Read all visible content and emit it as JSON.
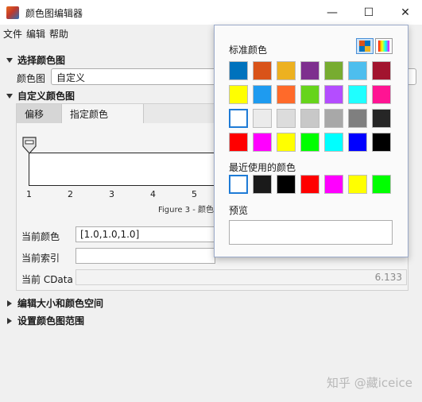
{
  "window": {
    "title": "颜色图编辑器",
    "min_symbol": "—",
    "max_symbol": "☐",
    "close_symbol": "✕"
  },
  "menu": [
    "文件",
    "编辑",
    "帮助"
  ],
  "sections": {
    "select_colormap": {
      "header": "选择颜色图",
      "colormap_label": "颜色图",
      "colormap_value": "自定义"
    },
    "custom_colormap": {
      "header": "自定义颜色图",
      "tabs": [
        "偏移",
        "指定颜色"
      ],
      "axis_ticks": [
        "1",
        "2",
        "3",
        "4",
        "5"
      ],
      "figure_label": "Figure 3 - 颜色",
      "current_color_label": "当前颜色",
      "current_color_value": "[1.0,1.0,1.0]",
      "current_index_label": "当前索引",
      "current_index_value": "",
      "current_cdata_label": "当前 CData",
      "current_cdata_value": "6.133"
    },
    "edit_size": {
      "header": "编辑大小和颜色空间"
    },
    "set_range": {
      "header": "设置颜色图范围"
    }
  },
  "popup": {
    "standard_colors_label": "标准颜色",
    "standard_colors": [
      [
        "#0072bd",
        "#d95319",
        "#edb120",
        "#7e2f8e",
        "#77ac30",
        "#4dbeee",
        "#a2142f"
      ],
      [
        "#ffff00",
        "#1e9bf0",
        "#ff6a2a",
        "#66d41b",
        "#b44dff",
        "#1fffff",
        "#ff1493"
      ],
      [
        "#ffffff",
        "#ebebeb",
        "#dcdcdc",
        "#c8c8c8",
        "#a8a8a8",
        "#7f7f7f",
        "#262626"
      ],
      [
        "#ff0000",
        "#ff00ff",
        "#ffff00",
        "#00ff00",
        "#00ffff",
        "#0000ff",
        "#000000"
      ]
    ],
    "recent_colors_label": "最近使用的颜色",
    "recent_colors": [
      "#ffffff",
      "#1a1a1a",
      "#000000",
      "#ff0000",
      "#ff00ff",
      "#ffff00",
      "#00ff00"
    ],
    "preview_label": "预览"
  },
  "watermark": "知乎 @藏iceice"
}
